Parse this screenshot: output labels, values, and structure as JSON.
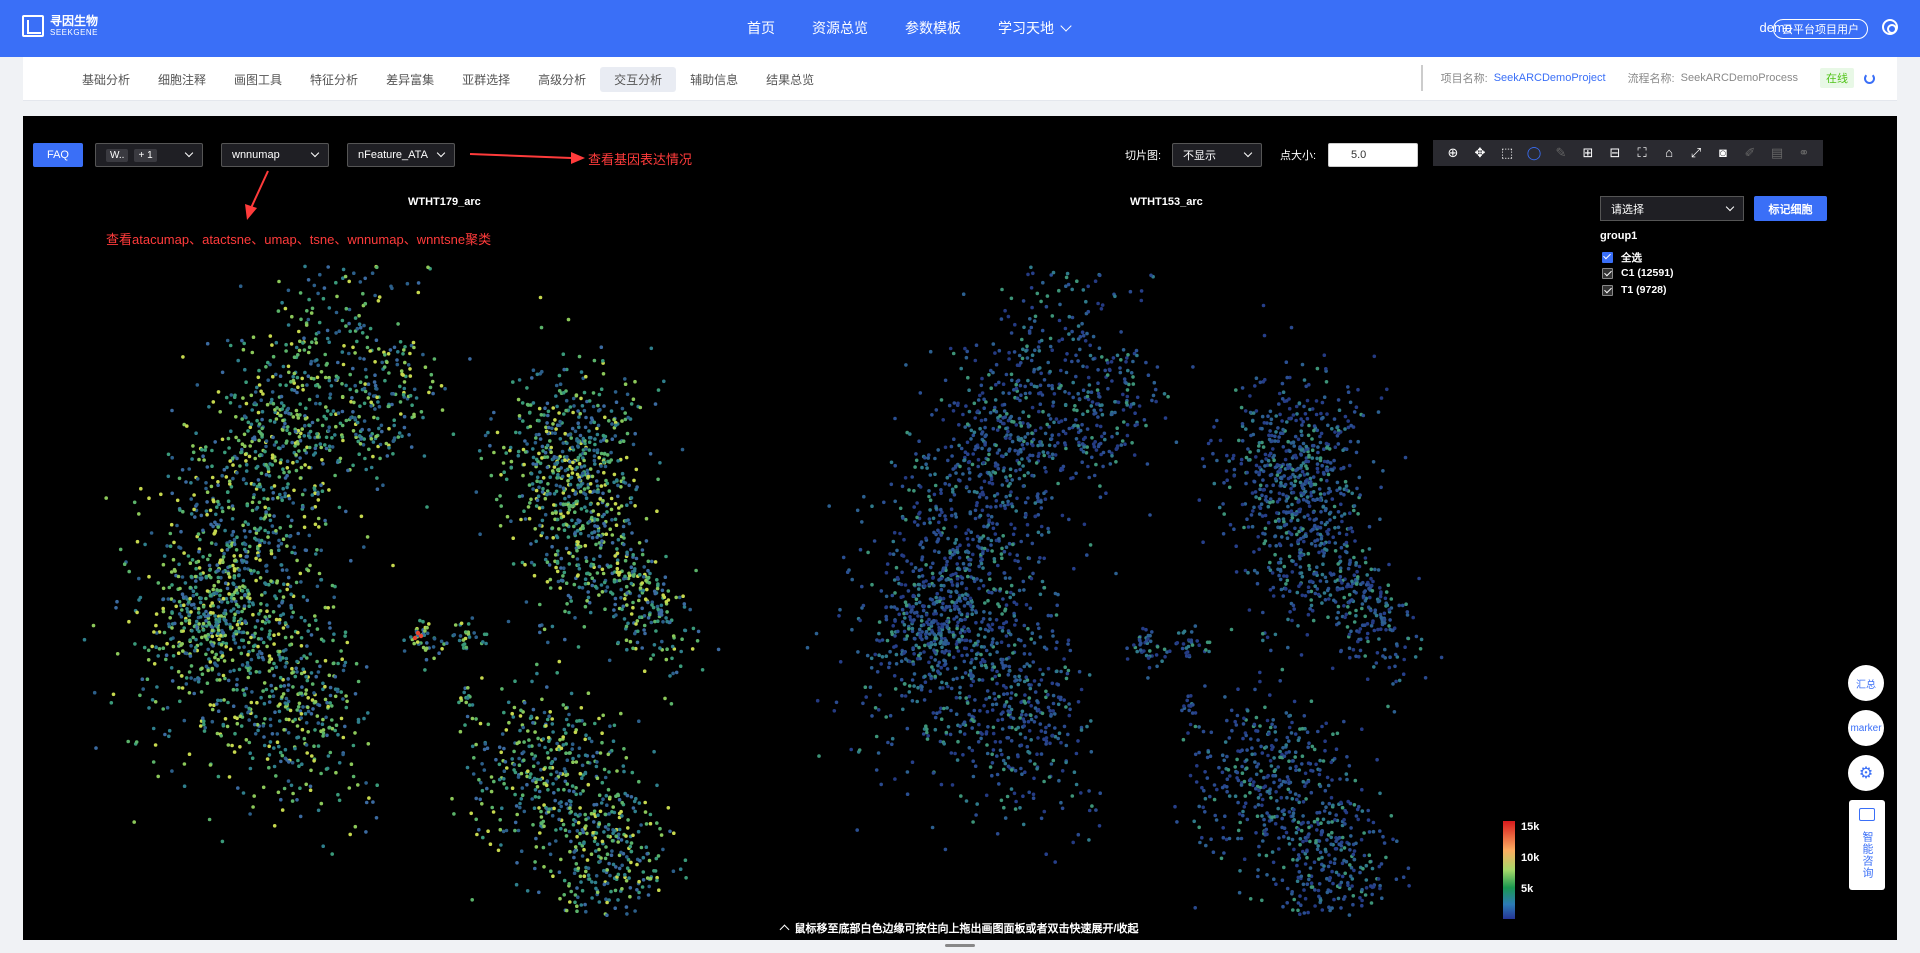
{
  "header": {
    "logo_cn": "寻因生物",
    "logo_en": "SEEKGENE",
    "nav": [
      "首页",
      "资源总览",
      "参数模板",
      "学习天地"
    ],
    "user": "demo",
    "role": "云平台项目用户"
  },
  "subnav": {
    "tabs": [
      "基础分析",
      "细胞注释",
      "画图工具",
      "特征分析",
      "差异富集",
      "亚群选择",
      "高级分析",
      "交互分析",
      "辅助信息",
      "结果总览"
    ],
    "active_tab": "交互分析",
    "project_label": "项目名称:",
    "project_value": "SeekARCDemoProject",
    "process_label": "流程名称:",
    "process_value": "SeekARCDemoProcess",
    "status": "在线"
  },
  "controls": {
    "faq": "FAQ",
    "sample_select": "W..",
    "sample_more": "+ 1",
    "reduction_select": "wnnumap",
    "feature_select": "nFeature_ATA",
    "slice_label": "切片图:",
    "slice_value": "不显示",
    "point_size_label": "点大小:",
    "point_size_value": "5.0"
  },
  "plots": {
    "left_title": "WTHT179_arc",
    "right_title": "WTHT153_arc"
  },
  "annotations": {
    "gene_expr": "查看基因表达情况",
    "clustering": "查看atacumap、atactsne、umap、tsne、wnnumap、wnntsne聚类"
  },
  "group_panel": {
    "select_placeholder": "请选择",
    "mark_button": "标记细胞",
    "group_name": "group1",
    "select_all": "全选",
    "items": [
      "C1 (12591)",
      "T1 (9728)"
    ]
  },
  "colorbar": {
    "labels": [
      "15k",
      "10k",
      "5k"
    ],
    "colors": [
      "#d7191c",
      "#fdae61",
      "#a6d96a",
      "#1a9850",
      "#2c7bb6",
      "#253494"
    ]
  },
  "hint": "鼠标移至底部白色边缘可按住向上拖出画图面板或者双击快速展开/收起",
  "float_buttons": {
    "summary": "汇总",
    "marker": "marker",
    "ask": "智能咨询"
  },
  "colors": {
    "brand": "#3a6ff7",
    "annotation": "#ff3b3b"
  }
}
